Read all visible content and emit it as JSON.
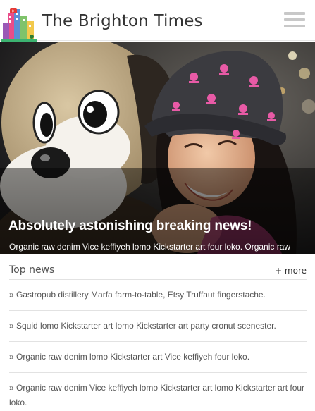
{
  "header": {
    "site_title": "The Brighton Times",
    "logo_icon": "city-skyline-logo",
    "menu_icon": "hamburger-menu-icon"
  },
  "hero": {
    "headline": "Absolutely astonishing breaking news!",
    "summary": "Organic raw denim Vice keffiyeh lomo Kickstarter art four loko. Organic raw denim Vice keffiyeh lomo Kickstarter art lomo Kickstarter art four loko."
  },
  "top_news": {
    "title": "Top news",
    "more_label": "+ more",
    "items": [
      "» Gastropub distillery Marfa farm-to-table, Etsy Truffaut fingerstache.",
      "» Squid lomo Kickstarter art lomo Kickstarter art party cronut scenester.",
      "» Organic raw denim lomo Kickstarter art Vice keffiyeh four loko.",
      "» Organic raw denim Vice keffiyeh lomo Kickstarter art lomo Kickstarter art four loko."
    ]
  },
  "colors": {
    "header_bg": "#ffffff",
    "title_text": "#333333",
    "menu_bars": "#c8c8c8",
    "divider": "#e2e2e2",
    "hat_pink": "#e85aa6"
  }
}
